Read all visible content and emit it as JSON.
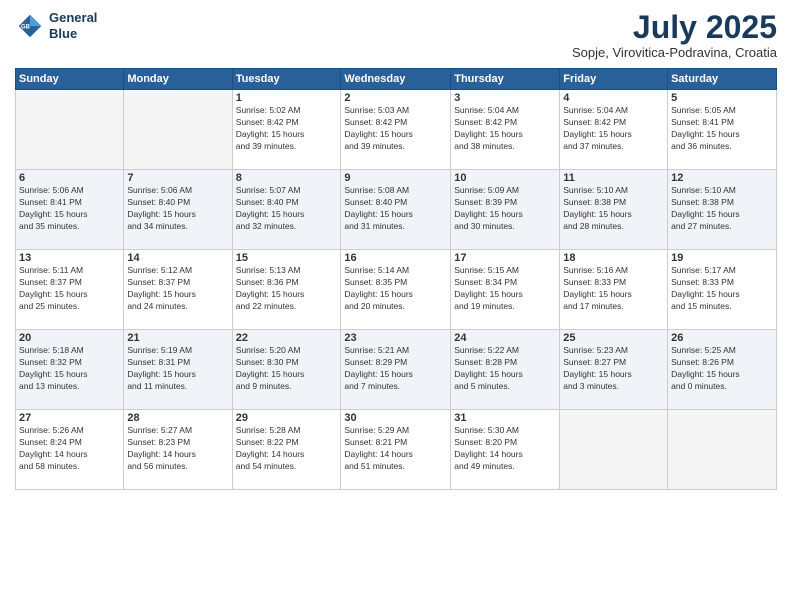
{
  "header": {
    "logo_line1": "General",
    "logo_line2": "Blue",
    "month": "July 2025",
    "location": "Sopje, Virovitica-Podravina, Croatia"
  },
  "days_of_week": [
    "Sunday",
    "Monday",
    "Tuesday",
    "Wednesday",
    "Thursday",
    "Friday",
    "Saturday"
  ],
  "weeks": [
    [
      {
        "day": "",
        "info": ""
      },
      {
        "day": "",
        "info": ""
      },
      {
        "day": "1",
        "info": "Sunrise: 5:02 AM\nSunset: 8:42 PM\nDaylight: 15 hours\nand 39 minutes."
      },
      {
        "day": "2",
        "info": "Sunrise: 5:03 AM\nSunset: 8:42 PM\nDaylight: 15 hours\nand 39 minutes."
      },
      {
        "day": "3",
        "info": "Sunrise: 5:04 AM\nSunset: 8:42 PM\nDaylight: 15 hours\nand 38 minutes."
      },
      {
        "day": "4",
        "info": "Sunrise: 5:04 AM\nSunset: 8:42 PM\nDaylight: 15 hours\nand 37 minutes."
      },
      {
        "day": "5",
        "info": "Sunrise: 5:05 AM\nSunset: 8:41 PM\nDaylight: 15 hours\nand 36 minutes."
      }
    ],
    [
      {
        "day": "6",
        "info": "Sunrise: 5:06 AM\nSunset: 8:41 PM\nDaylight: 15 hours\nand 35 minutes."
      },
      {
        "day": "7",
        "info": "Sunrise: 5:06 AM\nSunset: 8:40 PM\nDaylight: 15 hours\nand 34 minutes."
      },
      {
        "day": "8",
        "info": "Sunrise: 5:07 AM\nSunset: 8:40 PM\nDaylight: 15 hours\nand 32 minutes."
      },
      {
        "day": "9",
        "info": "Sunrise: 5:08 AM\nSunset: 8:40 PM\nDaylight: 15 hours\nand 31 minutes."
      },
      {
        "day": "10",
        "info": "Sunrise: 5:09 AM\nSunset: 8:39 PM\nDaylight: 15 hours\nand 30 minutes."
      },
      {
        "day": "11",
        "info": "Sunrise: 5:10 AM\nSunset: 8:38 PM\nDaylight: 15 hours\nand 28 minutes."
      },
      {
        "day": "12",
        "info": "Sunrise: 5:10 AM\nSunset: 8:38 PM\nDaylight: 15 hours\nand 27 minutes."
      }
    ],
    [
      {
        "day": "13",
        "info": "Sunrise: 5:11 AM\nSunset: 8:37 PM\nDaylight: 15 hours\nand 25 minutes."
      },
      {
        "day": "14",
        "info": "Sunrise: 5:12 AM\nSunset: 8:37 PM\nDaylight: 15 hours\nand 24 minutes."
      },
      {
        "day": "15",
        "info": "Sunrise: 5:13 AM\nSunset: 8:36 PM\nDaylight: 15 hours\nand 22 minutes."
      },
      {
        "day": "16",
        "info": "Sunrise: 5:14 AM\nSunset: 8:35 PM\nDaylight: 15 hours\nand 20 minutes."
      },
      {
        "day": "17",
        "info": "Sunrise: 5:15 AM\nSunset: 8:34 PM\nDaylight: 15 hours\nand 19 minutes."
      },
      {
        "day": "18",
        "info": "Sunrise: 5:16 AM\nSunset: 8:33 PM\nDaylight: 15 hours\nand 17 minutes."
      },
      {
        "day": "19",
        "info": "Sunrise: 5:17 AM\nSunset: 8:33 PM\nDaylight: 15 hours\nand 15 minutes."
      }
    ],
    [
      {
        "day": "20",
        "info": "Sunrise: 5:18 AM\nSunset: 8:32 PM\nDaylight: 15 hours\nand 13 minutes."
      },
      {
        "day": "21",
        "info": "Sunrise: 5:19 AM\nSunset: 8:31 PM\nDaylight: 15 hours\nand 11 minutes."
      },
      {
        "day": "22",
        "info": "Sunrise: 5:20 AM\nSunset: 8:30 PM\nDaylight: 15 hours\nand 9 minutes."
      },
      {
        "day": "23",
        "info": "Sunrise: 5:21 AM\nSunset: 8:29 PM\nDaylight: 15 hours\nand 7 minutes."
      },
      {
        "day": "24",
        "info": "Sunrise: 5:22 AM\nSunset: 8:28 PM\nDaylight: 15 hours\nand 5 minutes."
      },
      {
        "day": "25",
        "info": "Sunrise: 5:23 AM\nSunset: 8:27 PM\nDaylight: 15 hours\nand 3 minutes."
      },
      {
        "day": "26",
        "info": "Sunrise: 5:25 AM\nSunset: 8:26 PM\nDaylight: 15 hours\nand 0 minutes."
      }
    ],
    [
      {
        "day": "27",
        "info": "Sunrise: 5:26 AM\nSunset: 8:24 PM\nDaylight: 14 hours\nand 58 minutes."
      },
      {
        "day": "28",
        "info": "Sunrise: 5:27 AM\nSunset: 8:23 PM\nDaylight: 14 hours\nand 56 minutes."
      },
      {
        "day": "29",
        "info": "Sunrise: 5:28 AM\nSunset: 8:22 PM\nDaylight: 14 hours\nand 54 minutes."
      },
      {
        "day": "30",
        "info": "Sunrise: 5:29 AM\nSunset: 8:21 PM\nDaylight: 14 hours\nand 51 minutes."
      },
      {
        "day": "31",
        "info": "Sunrise: 5:30 AM\nSunset: 8:20 PM\nDaylight: 14 hours\nand 49 minutes."
      },
      {
        "day": "",
        "info": ""
      },
      {
        "day": "",
        "info": ""
      }
    ]
  ]
}
